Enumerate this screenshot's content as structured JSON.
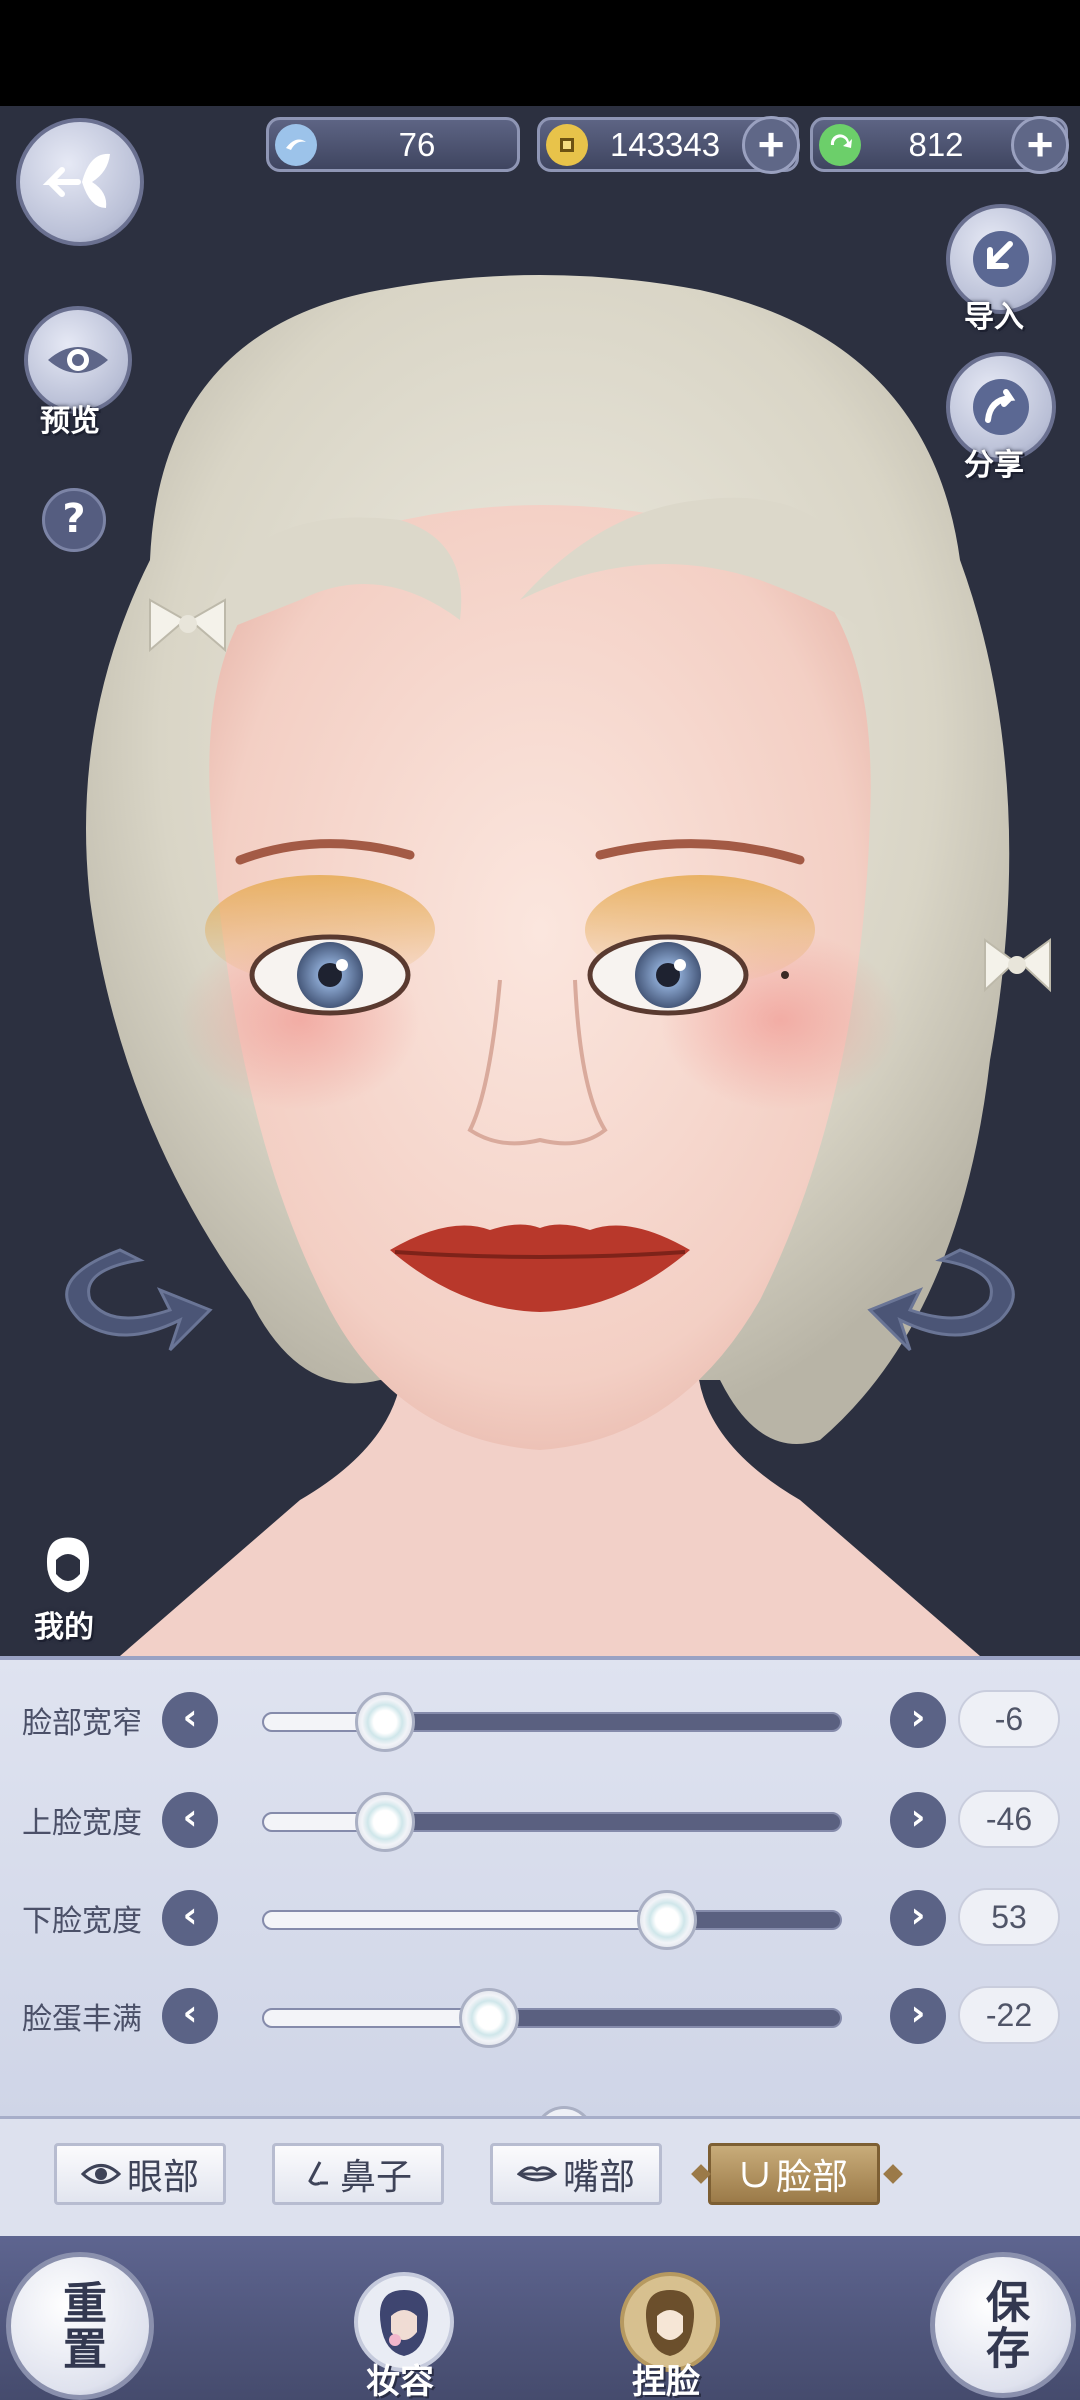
{
  "currencies": [
    {
      "name": "jade",
      "value": "76",
      "has_plus": false,
      "color": "#9cc3ea"
    },
    {
      "name": "copper-coin",
      "value": "143343",
      "has_plus": true,
      "color": "#e8c34a"
    },
    {
      "name": "green-token",
      "value": "812",
      "has_plus": true,
      "color": "#6ccf6a"
    }
  ],
  "side": {
    "preview_label": "预览",
    "help_glyph": "?",
    "mine_label": "我的",
    "import_label": "导入",
    "share_label": "分享"
  },
  "sliders": [
    {
      "label": "脸部宽窄",
      "value": "-6",
      "position": 0.21
    },
    {
      "label": "上脸宽度",
      "value": "-46",
      "position": 0.21
    },
    {
      "label": "下脸宽度",
      "value": "53",
      "position": 0.7
    },
    {
      "label": "脸蛋丰满",
      "value": "-22",
      "position": 0.39
    }
  ],
  "tabs": [
    {
      "label": "眼部",
      "icon": "eye-icon",
      "active": false
    },
    {
      "label": "鼻子",
      "icon": "nose-icon",
      "active": false
    },
    {
      "label": "嘴部",
      "icon": "lips-icon",
      "active": false
    },
    {
      "label": "脸部",
      "icon": "face-icon",
      "active": true
    }
  ],
  "bottom": {
    "reset_label": "重置",
    "makeup_label": "妆容",
    "face_label": "捏脸",
    "save_label": "保存"
  },
  "colors": {
    "background": "#2c3040",
    "accent_gold": "#a8895a",
    "panel": "#dfe3f0"
  }
}
